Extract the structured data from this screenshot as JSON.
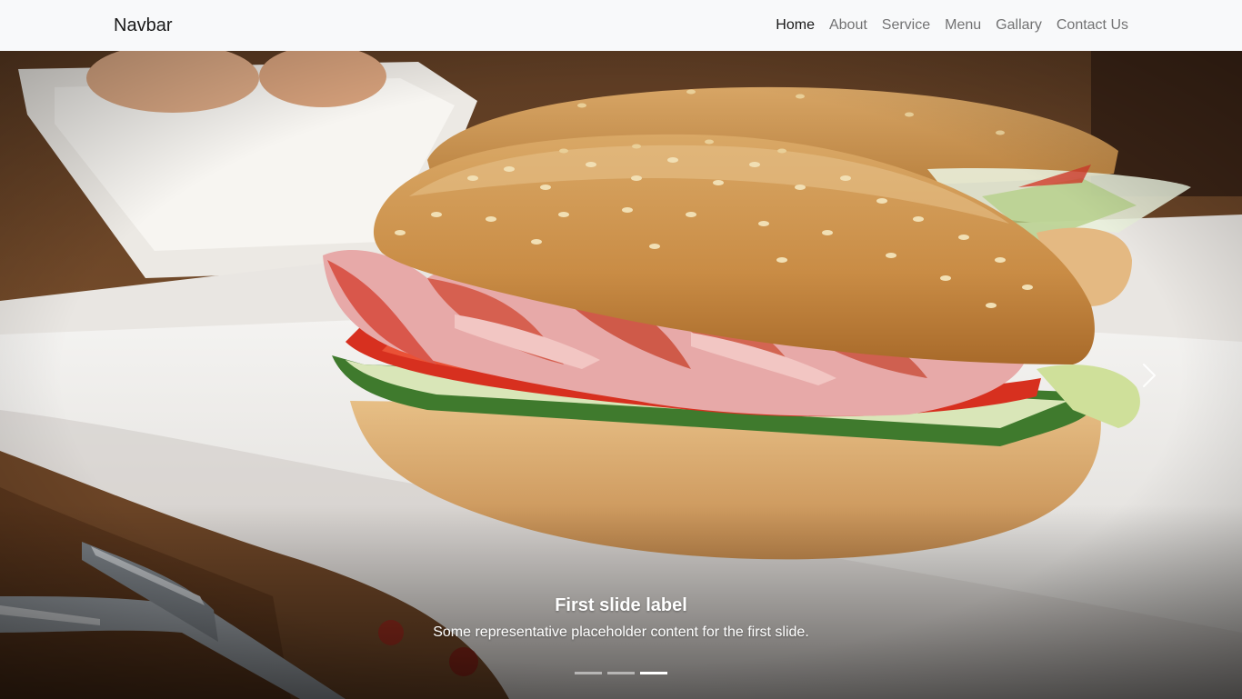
{
  "navbar": {
    "brand": "Navbar",
    "links": [
      {
        "label": "Home",
        "active": true
      },
      {
        "label": "About",
        "active": false
      },
      {
        "label": "Service",
        "active": false
      },
      {
        "label": "Menu",
        "active": false
      },
      {
        "label": "Gallary",
        "active": false
      },
      {
        "label": "Contact Us",
        "active": false
      }
    ]
  },
  "carousel": {
    "caption": {
      "title": "First slide label",
      "text": "Some representative placeholder content for the first slide."
    },
    "indicators": [
      {
        "active": false
      },
      {
        "active": false
      },
      {
        "active": true
      }
    ],
    "controls": {
      "next_icon": "chevron-right-icon"
    }
  },
  "colors": {
    "navbar_bg": "#f8f9fa",
    "caption_text": "#ffffff"
  }
}
